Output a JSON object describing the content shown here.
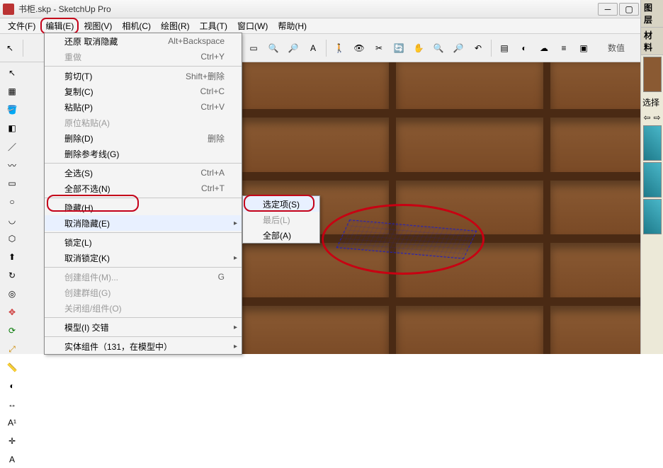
{
  "window": {
    "title": "书柜.skp - SketchUp Pro"
  },
  "menubar": [
    "文件(F)",
    "编辑(E)",
    "视图(V)",
    "相机(C)",
    "绘图(R)",
    "工具(T)",
    "窗口(W)",
    "帮助(H)"
  ],
  "menubar_highlight_index": 1,
  "toolbar_field_label": "数值",
  "right": {
    "panel1": "图层",
    "panel2": "材料",
    "panel3": "选择"
  },
  "edit_menu": [
    {
      "label": "还原 取消隐藏",
      "shortcut": "Alt+Backspace"
    },
    {
      "label": "重做",
      "shortcut": "Ctrl+Y",
      "disabled": true
    },
    {
      "sep": true
    },
    {
      "label": "剪切(T)",
      "shortcut": "Shift+删除"
    },
    {
      "label": "复制(C)",
      "shortcut": "Ctrl+C"
    },
    {
      "label": "粘贴(P)",
      "shortcut": "Ctrl+V"
    },
    {
      "label": "原位粘贴(A)",
      "disabled": true
    },
    {
      "label": "删除(D)",
      "shortcut": "删除"
    },
    {
      "label": "删除参考线(G)"
    },
    {
      "sep": true
    },
    {
      "label": "全选(S)",
      "shortcut": "Ctrl+A"
    },
    {
      "label": "全部不选(N)",
      "shortcut": "Ctrl+T"
    },
    {
      "sep": true
    },
    {
      "label": "隐藏(H)"
    },
    {
      "label": "取消隐藏(E)",
      "submenu": true,
      "hl": true
    },
    {
      "sep": true
    },
    {
      "label": "锁定(L)"
    },
    {
      "label": "取消锁定(K)",
      "submenu": true
    },
    {
      "sep": true
    },
    {
      "label": "创建组件(M)...",
      "shortcut": "G",
      "disabled": true
    },
    {
      "label": "创建群组(G)",
      "disabled": true
    },
    {
      "label": "关闭组/组件(O)",
      "disabled": true
    },
    {
      "sep": true
    },
    {
      "label": "模型(I) 交错",
      "submenu": true
    },
    {
      "sep": true
    },
    {
      "label": "实体组件（131，在模型中）",
      "submenu": true
    }
  ],
  "submenu": [
    {
      "label": "选定项(S)",
      "hl": true
    },
    {
      "label": "最后(L)",
      "disabled": true
    },
    {
      "label": "全部(A)"
    }
  ]
}
